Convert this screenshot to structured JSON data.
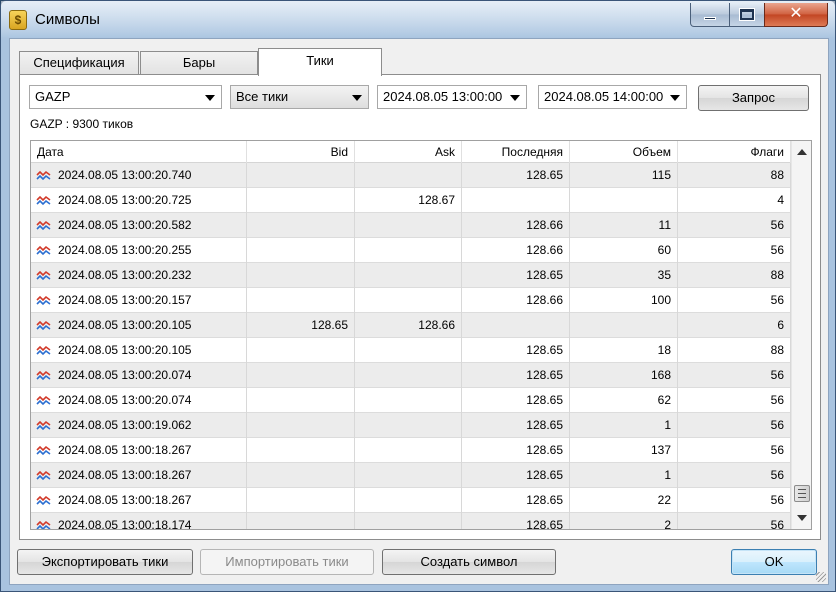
{
  "window": {
    "title": "Символы",
    "close_glyph": "✕"
  },
  "tabs": [
    {
      "label": "Спецификация"
    },
    {
      "label": "Бары"
    },
    {
      "label": "Тики"
    }
  ],
  "filters": {
    "symbol": "GAZP",
    "tick_type": "Все тики",
    "from": "2024.08.05 13:00:00",
    "to": "2024.08.05 14:00:00",
    "query_label": "Запрос"
  },
  "info": "GAZP : 9300 тиков",
  "table": {
    "columns": [
      "Дата",
      "Bid",
      "Ask",
      "Последняя",
      "Объем",
      "Флаги"
    ],
    "rows": [
      [
        "2024.08.05 13:00:20.740",
        "",
        "",
        "128.65",
        "115",
        "88"
      ],
      [
        "2024.08.05 13:00:20.725",
        "",
        "128.67",
        "",
        "",
        "4"
      ],
      [
        "2024.08.05 13:00:20.582",
        "",
        "",
        "128.66",
        "11",
        "56"
      ],
      [
        "2024.08.05 13:00:20.255",
        "",
        "",
        "128.66",
        "60",
        "56"
      ],
      [
        "2024.08.05 13:00:20.232",
        "",
        "",
        "128.65",
        "35",
        "88"
      ],
      [
        "2024.08.05 13:00:20.157",
        "",
        "",
        "128.66",
        "100",
        "56"
      ],
      [
        "2024.08.05 13:00:20.105",
        "128.65",
        "128.66",
        "",
        "",
        "6"
      ],
      [
        "2024.08.05 13:00:20.105",
        "",
        "",
        "128.65",
        "18",
        "88"
      ],
      [
        "2024.08.05 13:00:20.074",
        "",
        "",
        "128.65",
        "168",
        "56"
      ],
      [
        "2024.08.05 13:00:20.074",
        "",
        "",
        "128.65",
        "62",
        "56"
      ],
      [
        "2024.08.05 13:00:19.062",
        "",
        "",
        "128.65",
        "1",
        "56"
      ],
      [
        "2024.08.05 13:00:18.267",
        "",
        "",
        "128.65",
        "137",
        "56"
      ],
      [
        "2024.08.05 13:00:18.267",
        "",
        "",
        "128.65",
        "1",
        "56"
      ],
      [
        "2024.08.05 13:00:18.267",
        "",
        "",
        "128.65",
        "22",
        "56"
      ],
      [
        "2024.08.05 13:00:18.174",
        "",
        "",
        "128.65",
        "2",
        "56"
      ]
    ]
  },
  "buttons": {
    "export": "Экспортировать тики",
    "import": "Импортировать тики",
    "create": "Создать символ",
    "ok": "OK"
  },
  "icons": {
    "app": "dollar-icon",
    "row": "tick-wave-icon"
  },
  "colors": {
    "wave_red": "#d23a2a",
    "wave_blue": "#2b6fd1"
  }
}
